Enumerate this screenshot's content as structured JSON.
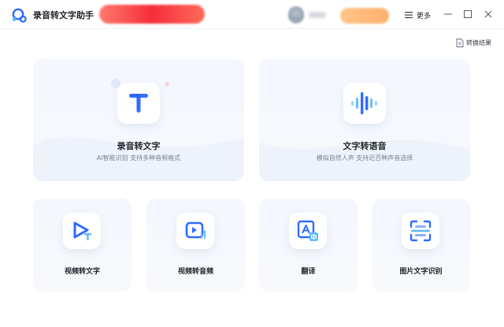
{
  "app": {
    "title": "录音转文字助手",
    "logo_icon": "app-logo-icon"
  },
  "titlebar": {
    "more_label": "更多",
    "menu_icon": "menu-icon",
    "minimize_icon": "minimize-icon",
    "maximize_icon": "maximize-icon",
    "close_icon": "close-icon"
  },
  "toolbar": {
    "result_label": "转换结果",
    "result_icon": "document-icon"
  },
  "features": {
    "main": [
      {
        "title": "录音转文字",
        "subtitle": "AI智能识别 支持多种音频格式",
        "icon": "text-t-icon"
      },
      {
        "title": "文字转语音",
        "subtitle": "模拟自然人声 支持近百种声音选择",
        "icon": "sound-wave-icon"
      }
    ],
    "tools": [
      {
        "title": "视频转文字",
        "icon": "video-to-text-icon"
      },
      {
        "title": "视频转音频",
        "icon": "video-to-audio-icon"
      },
      {
        "title": "翻译",
        "icon": "translate-icon"
      },
      {
        "title": "图片文字识别",
        "icon": "image-ocr-icon"
      }
    ]
  },
  "colors": {
    "accent": "#2f6bff",
    "accent_light": "#5ab8ff",
    "card_bg": "#f5f7fc",
    "subtitle": "#7a818d"
  }
}
